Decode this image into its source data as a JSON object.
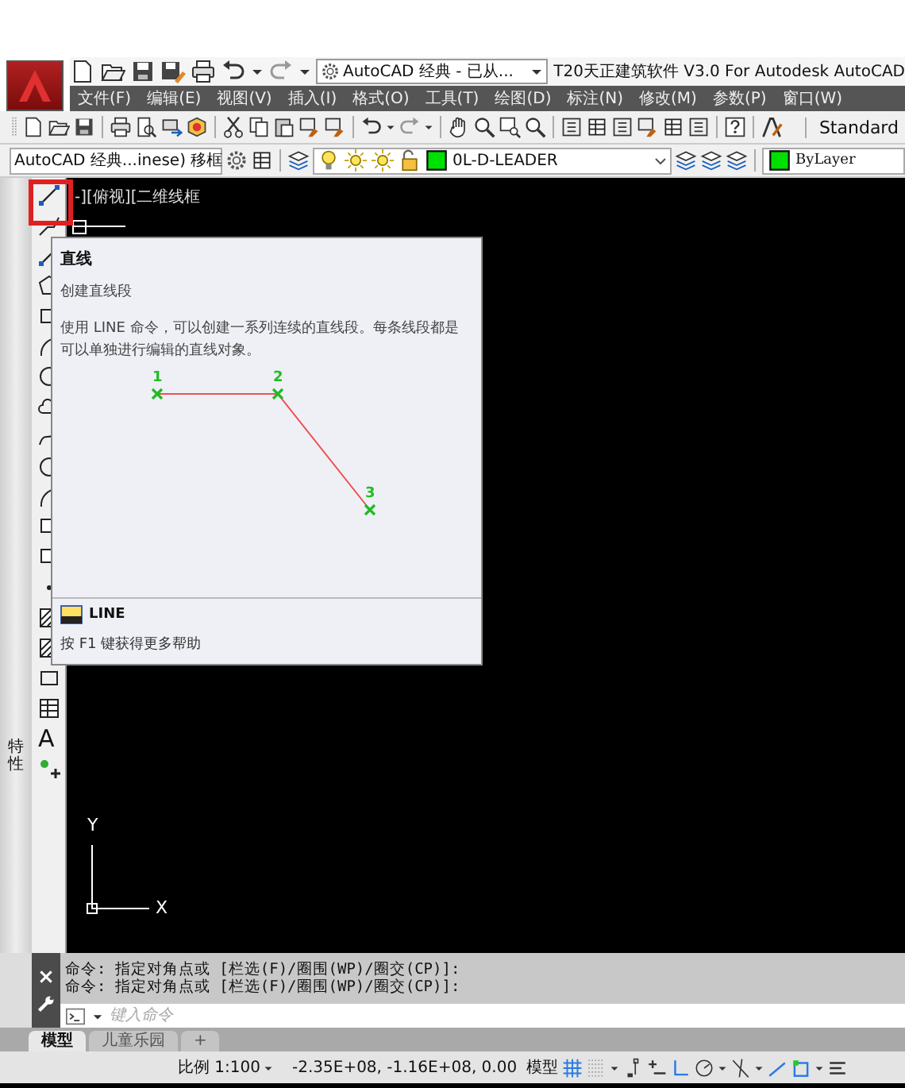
{
  "window": {
    "title": "T20天正建筑软件 V3.0 For Autodesk AutoCAD"
  },
  "quick_access": {
    "workspace": "AutoCAD 经典 - 已从..."
  },
  "menu": [
    "文件(F)",
    "编辑(E)",
    "视图(V)",
    "插入(I)",
    "格式(O)",
    "工具(T)",
    "绘图(D)",
    "标注(N)",
    "修改(M)",
    "参数(P)",
    "窗口(W)"
  ],
  "standard_toolbar": {
    "text_style": "Standard"
  },
  "workspace_toolbar": {
    "workspace": "AutoCAD 经典...inese) 移框",
    "layer": "0L-D-LEADER",
    "color_setting": "ByLayer"
  },
  "side_palette": {
    "title": "特性"
  },
  "draw_toolbar": {
    "text_tool": "A"
  },
  "viewport_label": "-][俯视][二维线框",
  "tooltip": {
    "title": "直线",
    "subtitle": "创建直线段",
    "description": "使用 LINE 命令，可以创建一系列连续的直线段。每条线段都是可以单独进行编辑的直线对象。",
    "diagram_points": [
      "1",
      "2",
      "3"
    ],
    "command": "LINE",
    "help": "按 F1 键获得更多帮助"
  },
  "ucs": {
    "y": "Y",
    "x": "X"
  },
  "command_line": {
    "history": [
      "命令: 指定对角点或 [栏选(F)/圈围(WP)/圈交(CP)]:",
      "命令: 指定对角点或 [栏选(F)/圈围(WP)/圈交(CP)]:"
    ],
    "placeholder": "键入命令"
  },
  "layout_tabs": [
    {
      "label": "模型",
      "selected": true
    },
    {
      "label": "儿童乐园",
      "selected": false
    }
  ],
  "new_tab": "+",
  "status_bar": {
    "scale": "比例 1:100",
    "coordinates": "-2.35E+08, -1.16E+08, 0.00",
    "space": "模型"
  }
}
